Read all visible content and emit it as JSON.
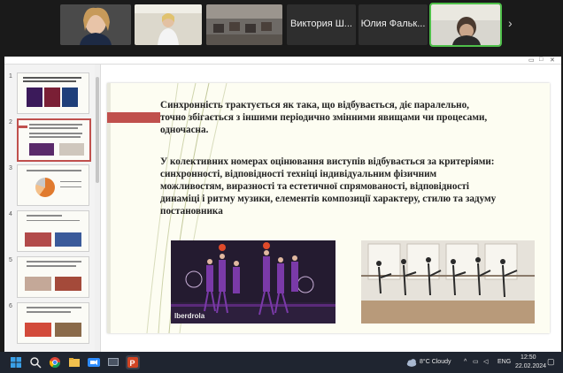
{
  "participants": [
    {
      "type": "video",
      "label": ""
    },
    {
      "type": "video",
      "label": ""
    },
    {
      "type": "video",
      "label": ""
    },
    {
      "type": "name",
      "label": "Виктория Ш..."
    },
    {
      "type": "name",
      "label": "Юлия Фальк..."
    },
    {
      "type": "video",
      "label": ""
    }
  ],
  "slide_thumbnails": [
    {
      "number": "1",
      "selected": false
    },
    {
      "number": "2",
      "selected": true
    },
    {
      "number": "3",
      "selected": false
    },
    {
      "number": "4",
      "selected": false
    },
    {
      "number": "5",
      "selected": false
    },
    {
      "number": "6",
      "selected": false
    }
  ],
  "slide": {
    "paragraph1": "Синхронність   трактується як така, що відбувається, діє паралельно,  точно збігається з іншими періодично змінними явищами чи процесами, одночасна.",
    "paragraph2": "У колективних номерах оцінювання виступів відбувається за критеріями: синхронності, відповідності техніці індивідуальним фізичним можливостям, виразності та естетичної спрямованості, відповідності динаміці і ритму музики, елементів композиції характеру, стилю та задуму постановника",
    "photo1_caption": "Iberdrola",
    "accent_color": "#c0504d"
  },
  "taskbar": {
    "weather": "8°C  Cloudy",
    "language": "ENG",
    "time": "12:50",
    "date": "22.02.2024"
  }
}
